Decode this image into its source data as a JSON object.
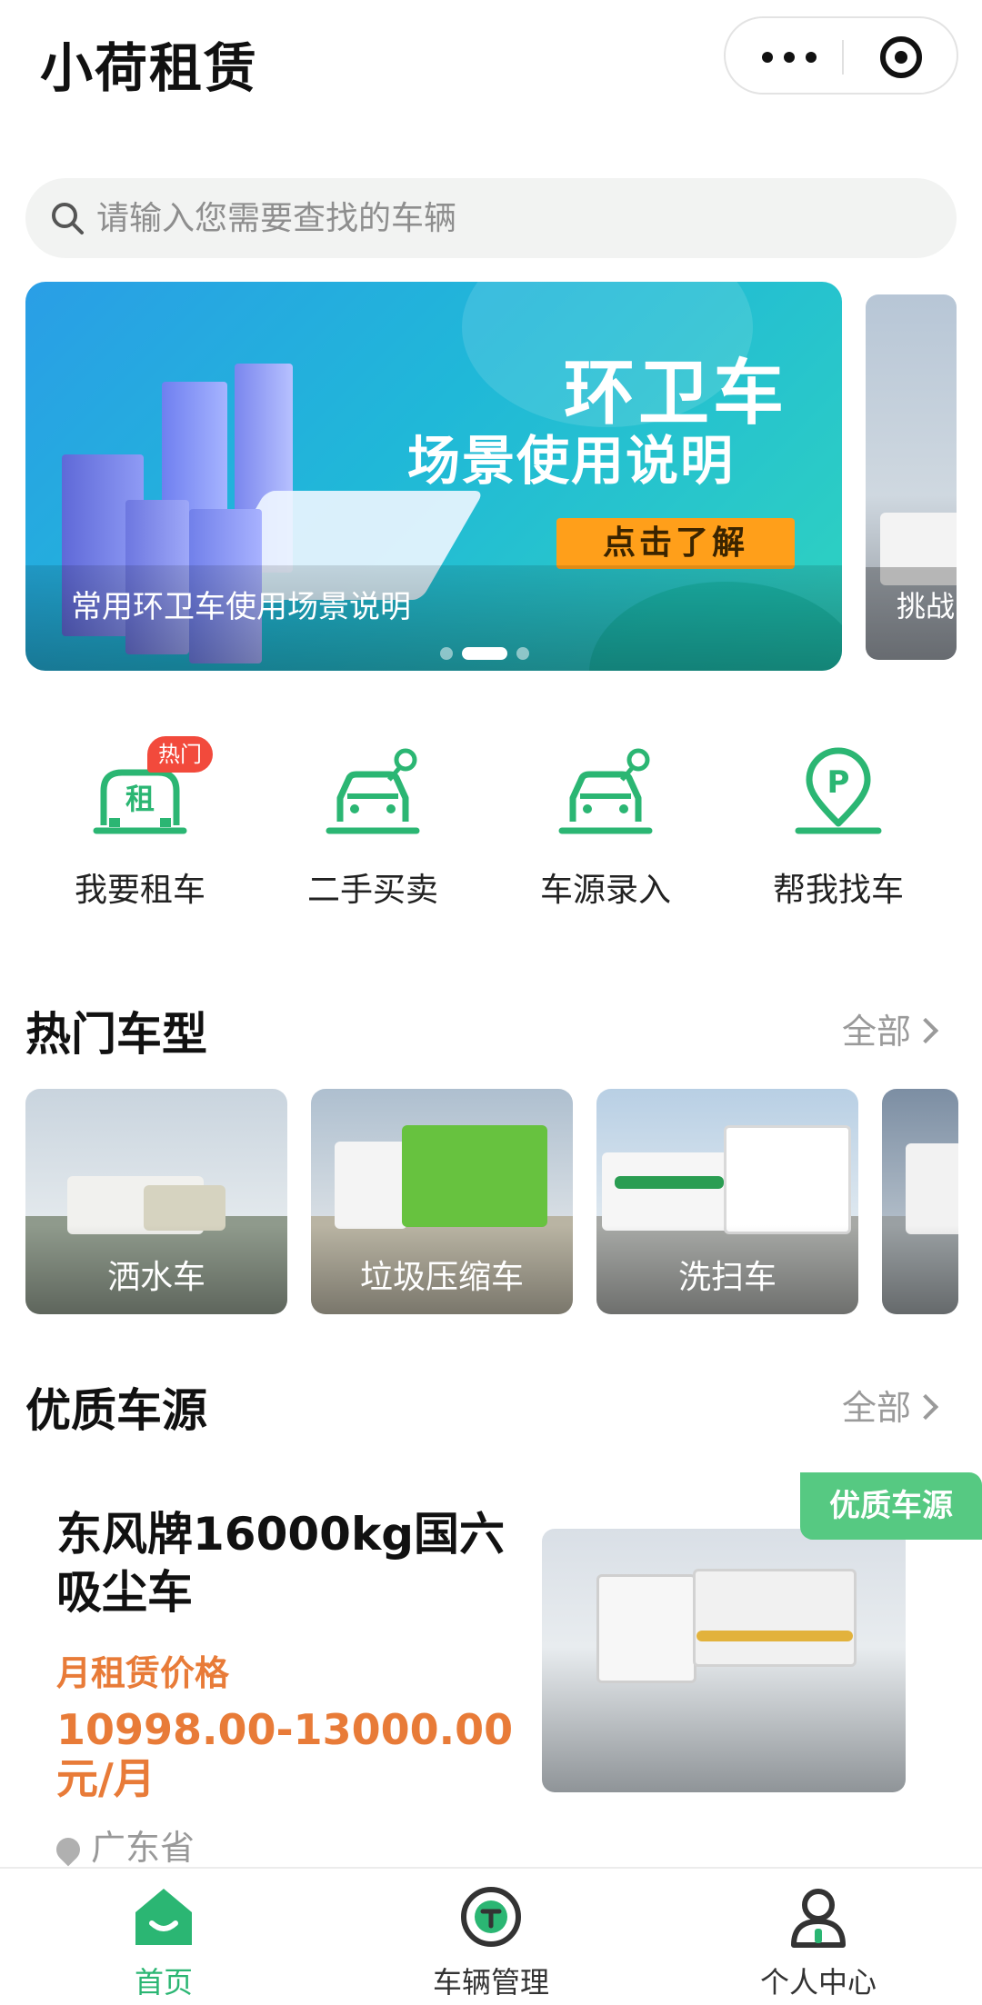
{
  "header": {
    "title": "小荷租赁",
    "more_icon": "more-icon",
    "close_icon": "target-icon"
  },
  "search": {
    "placeholder": "请输入您需要查找的车辆",
    "icon": "search-icon"
  },
  "banner": {
    "headline": "环卫车",
    "subheadline": "场景使用说明",
    "cta": "点击了解",
    "caption": "常用环卫车使用场景说明",
    "next_caption": "挑战",
    "indicator_count": 3,
    "indicator_active": 2
  },
  "menu": {
    "items": [
      {
        "label": "我要租车",
        "icon": "rent-car-icon",
        "icon_text": "租",
        "badge": "热门"
      },
      {
        "label": "二手买卖",
        "icon": "used-car-icon"
      },
      {
        "label": "车源录入",
        "icon": "car-entry-icon"
      },
      {
        "label": "帮我找车",
        "icon": "parking-pin-icon",
        "icon_text": "P"
      }
    ]
  },
  "hot_types": {
    "title": "热门车型",
    "more": "全部",
    "items": [
      {
        "label": "洒水车"
      },
      {
        "label": "垃圾压缩车"
      },
      {
        "label": "洗扫车"
      }
    ]
  },
  "quality": {
    "title": "优质车源",
    "more": "全部",
    "listing": {
      "badge": "优质车源",
      "name": "东风牌16000kg国六吸尘车",
      "price_label": "月租赁价格",
      "price": "10998.00-13000.00元/月",
      "location": "广东省"
    }
  },
  "tabbar": {
    "items": [
      {
        "label": "首页",
        "icon": "home-icon",
        "active": true
      },
      {
        "label": "车辆管理",
        "icon": "vehicle-manage-icon",
        "active": false
      },
      {
        "label": "个人中心",
        "icon": "profile-icon",
        "active": false
      }
    ]
  },
  "colors": {
    "brand_green": "#2bb673",
    "price_orange": "#e87b38",
    "hot_red": "#f24a3c",
    "cta_orange": "#ff9f1a"
  }
}
